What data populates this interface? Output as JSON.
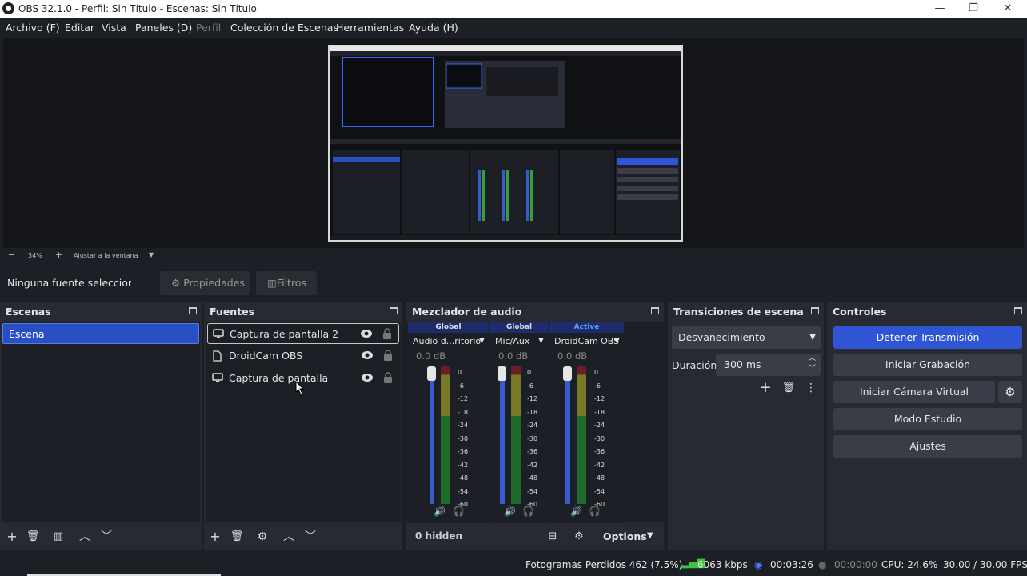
{
  "window": {
    "title": "OBS 32.1.0 - Perfil: Sin Título - Escenas: Sin Título",
    "minimize": "—",
    "maximize": "❐",
    "close": "✕"
  },
  "menu": {
    "archivo": "Archivo (F)",
    "editar": "Editar",
    "vista": "Vista",
    "paneles": "Paneles (D)",
    "perfil": "Perfil",
    "coleccion": "Colección de Escenas",
    "herramientas": "Herramientas",
    "ayuda": "Ayuda (H)"
  },
  "zoom": {
    "minus": "−",
    "value": "34%",
    "plus": "+",
    "fit": "Ajustar a la ventana"
  },
  "context": {
    "no_source": "Ninguna fuente seleccionada",
    "properties": "Propiedades",
    "filters": "Filtros"
  },
  "scenes": {
    "title": "Escenas",
    "items": [
      "Escena"
    ]
  },
  "sources": {
    "title": "Fuentes",
    "items": [
      {
        "name": "Captura de pantalla 2",
        "icon": "monitor-icon"
      },
      {
        "name": "DroidCam OBS",
        "icon": "file-icon"
      },
      {
        "name": "Captura de pantalla",
        "icon": "monitor-icon"
      }
    ]
  },
  "mixer": {
    "title": "Mezclador de audio",
    "hidden": "0 hidden",
    "options": "Options",
    "channels": [
      {
        "tag": "Global",
        "name": "Audio d...ritorio",
        "db": "0.0 dB",
        "active": false
      },
      {
        "tag": "Global",
        "name": "Mic/Aux",
        "db": "0.0 dB",
        "active": false
      },
      {
        "tag": "Active",
        "name": "DroidCam OBS",
        "db": "0.0 dB",
        "active": true
      }
    ],
    "ticks": [
      "0",
      "-6",
      "-12",
      "-18",
      "-24",
      "-30",
      "-36",
      "-42",
      "-48",
      "-54",
      "-60"
    ]
  },
  "transitions": {
    "title": "Transiciones de escena",
    "selected": "Desvanecimiento",
    "duration_label": "Duración",
    "duration_value": "300 ms"
  },
  "controls": {
    "title": "Controles",
    "stop_stream": "Detener Transmisión",
    "start_record": "Iniciar Grabación",
    "virtual_cam": "Iniciar Cámara Virtual",
    "studio": "Modo Estudio",
    "settings": "Ajustes"
  },
  "status": {
    "dropped": "Fotogramas Perdidos 462 (7.5%)",
    "bitrate": "6063 kbps",
    "stream_time": "00:03:26",
    "record_time": "00:00:00",
    "cpu": "CPU: 24.6%",
    "fps": "30.00 / 30.00 FPS"
  },
  "colors": {
    "accent": "#2f55d4",
    "panel": "#272a33",
    "background": "#1d1f26"
  }
}
